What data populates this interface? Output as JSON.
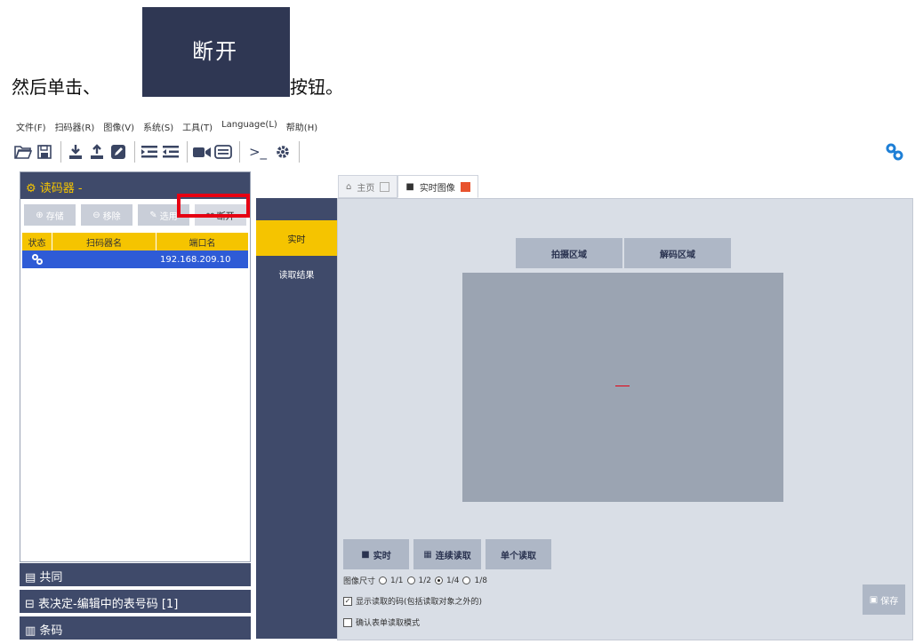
{
  "instruction": {
    "prefix": "然后单击、",
    "suffix": "按钮。"
  },
  "highlight_button": {
    "label": "断开"
  },
  "menu": [
    "文件(F)",
    "扫码器(R)",
    "图像(V)",
    "系统(S)",
    "工具(T)",
    "Language(L)",
    "帮助(H)"
  ],
  "toolbar": {
    "icons": [
      "folder-open-icon",
      "save-icon",
      "download-icon",
      "upload-icon",
      "edit-icon",
      "indent-icon",
      "outdent-icon",
      "camera-icon",
      "list-icon",
      "terminal-icon",
      "gear-icon"
    ],
    "terminal_label": ">_",
    "right_icon": "link-icon"
  },
  "reader_panel": {
    "title": "读码器 -",
    "buttons": [
      "存储",
      "移除",
      "选用",
      "断开"
    ],
    "columns": [
      "状态",
      "扫码器名",
      "端口名"
    ],
    "rows": [
      {
        "name": "",
        "port": "192.168.209.10"
      }
    ]
  },
  "accordions": [
    "共同",
    "表决定-编辑中的表号码 [1]",
    "条码"
  ],
  "mid_panel": {
    "items": [
      "实时",
      "读取结果"
    ]
  },
  "tabs": [
    {
      "label": "主页"
    },
    {
      "label": "实时图像"
    }
  ],
  "area_tabs": [
    "拍摄区域",
    "解码区域"
  ],
  "actions": {
    "live": "实时",
    "continuous": "连续读取",
    "single": "单个读取"
  },
  "image_size": {
    "label": "图像尺寸",
    "options": [
      "1/1",
      "1/2",
      "1/4",
      "1/8"
    ],
    "selected": "1/4"
  },
  "options": {
    "show_code": "显示读取的码(包括读取对象之外的)",
    "confirm": "确认表单读取模式"
  },
  "save": {
    "label": "保存"
  }
}
